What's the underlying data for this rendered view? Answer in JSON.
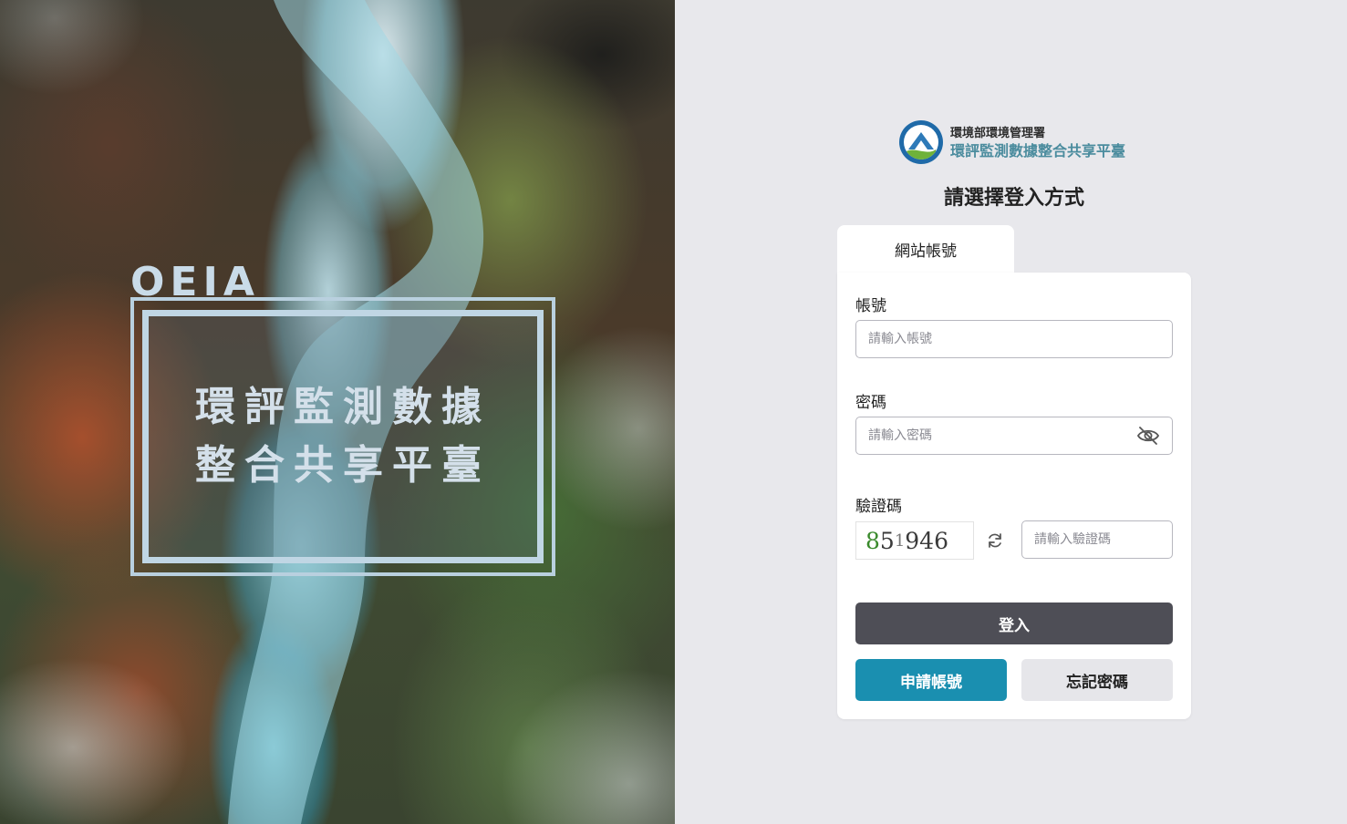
{
  "hero": {
    "brand": "OEIA",
    "title_line1": "環評監測數據",
    "title_line2": "整合共享平臺"
  },
  "header": {
    "org_name": "環境部環境管理署",
    "platform_name": "環評監測數據整合共享平臺",
    "logo_icon": "agency-logo-icon"
  },
  "login": {
    "title": "請選擇登入方式",
    "tabs": [
      {
        "label": "網站帳號",
        "active": true
      }
    ],
    "account": {
      "label": "帳號",
      "placeholder": "請輸入帳號",
      "value": ""
    },
    "password": {
      "label": "密碼",
      "placeholder": "請輸入密碼",
      "value": "",
      "toggle_icon": "eye-off-icon"
    },
    "captcha": {
      "label": "驗證碼",
      "image_text": [
        "8",
        "5",
        "1",
        "946"
      ],
      "refresh_icon": "refresh-icon",
      "placeholder": "請輸入驗證碼",
      "value": ""
    },
    "login_button": "登入",
    "apply_button": "申請帳號",
    "forgot_button": "忘記密碼"
  },
  "colors": {
    "login_button_bg": "#4e4e56",
    "apply_button_bg": "#1a8fb0",
    "forgot_button_bg": "#e6e6ea",
    "page_bg": "#e8e8ec"
  }
}
